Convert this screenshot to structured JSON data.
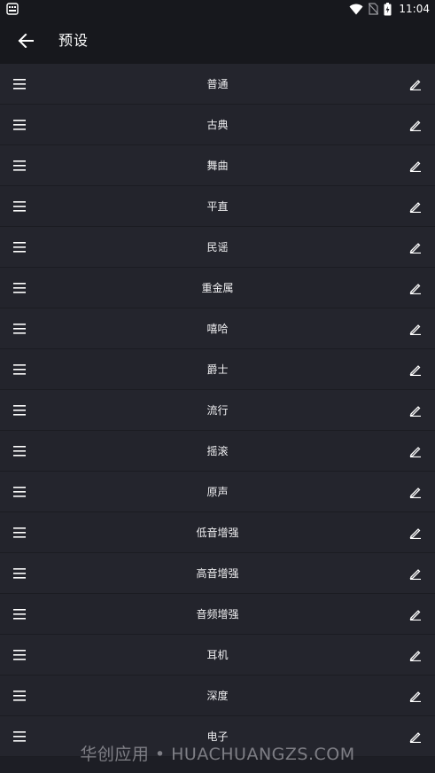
{
  "status_bar": {
    "time": "11:04",
    "icons": [
      "notification-app-icon",
      "wifi-icon",
      "no-sim-icon",
      "battery-icon"
    ]
  },
  "app_bar": {
    "back_icon": "arrow-left-icon",
    "title": "预设"
  },
  "presets": [
    {
      "name": "普通"
    },
    {
      "name": "古典"
    },
    {
      "name": "舞曲"
    },
    {
      "name": "平直"
    },
    {
      "name": "民谣"
    },
    {
      "name": "重金属"
    },
    {
      "name": "嘻哈"
    },
    {
      "name": "爵士"
    },
    {
      "name": "流行"
    },
    {
      "name": "摇滚"
    },
    {
      "name": "原声"
    },
    {
      "name": "低音增强"
    },
    {
      "name": "高音增强"
    },
    {
      "name": "音频增强"
    },
    {
      "name": "耳机"
    },
    {
      "name": "深度"
    },
    {
      "name": "电子"
    }
  ],
  "row_icons": {
    "handle": "drag-handle-icon",
    "edit": "edit-pencil-icon"
  },
  "watermark": "华创应用 • HUACHUANGZS.COM",
  "colors": {
    "background": "#1d1e25",
    "app_bar": "#17181d",
    "row": "#24252d",
    "text": "#f0f0f2"
  }
}
